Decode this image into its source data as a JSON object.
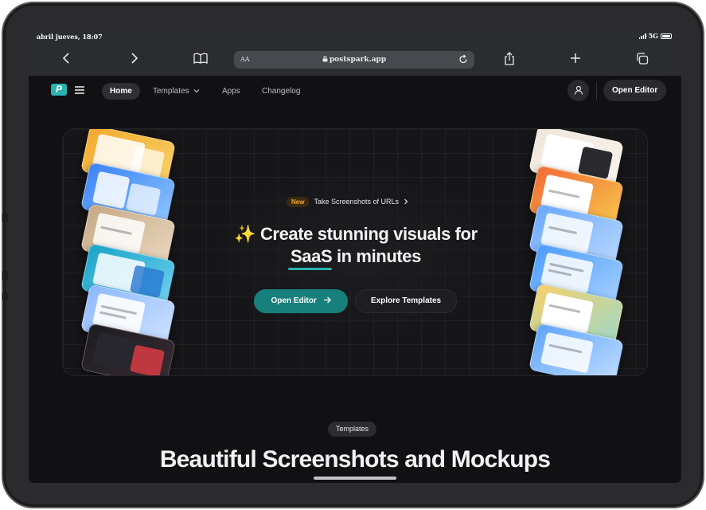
{
  "status_bar": {
    "time": "abril jueves, 18:07",
    "network": "5G"
  },
  "browser": {
    "aa_label": "AA",
    "url": "postspark.app",
    "icons": [
      "back-icon",
      "forward-icon",
      "book-icon",
      "lock-icon",
      "reload-icon",
      "share-icon",
      "plus-icon",
      "tabs-icon"
    ]
  },
  "nav": {
    "logo_text": "P",
    "items": [
      {
        "label": "Home",
        "active": true
      },
      {
        "label": "Templates",
        "has_dropdown": true
      },
      {
        "label": "Apps"
      },
      {
        "label": "Changelog"
      }
    ],
    "open_editor": "Open Editor"
  },
  "hero": {
    "badge": "New",
    "announcement": "Take Screenshots of URLs",
    "sparkle": "✨",
    "headline_line1": "Create stunning visuals for",
    "headline_line2": "SaaS in minutes",
    "primary_button": "Open Editor",
    "secondary_button": "Explore Templates"
  },
  "section": {
    "pill": "Templates",
    "title": "Beautiful Screenshots and Mockups"
  },
  "colors": {
    "accent": "#17807c",
    "brand": "#2ab3b0",
    "badge_text": "#f0a630",
    "background": "#111113"
  }
}
